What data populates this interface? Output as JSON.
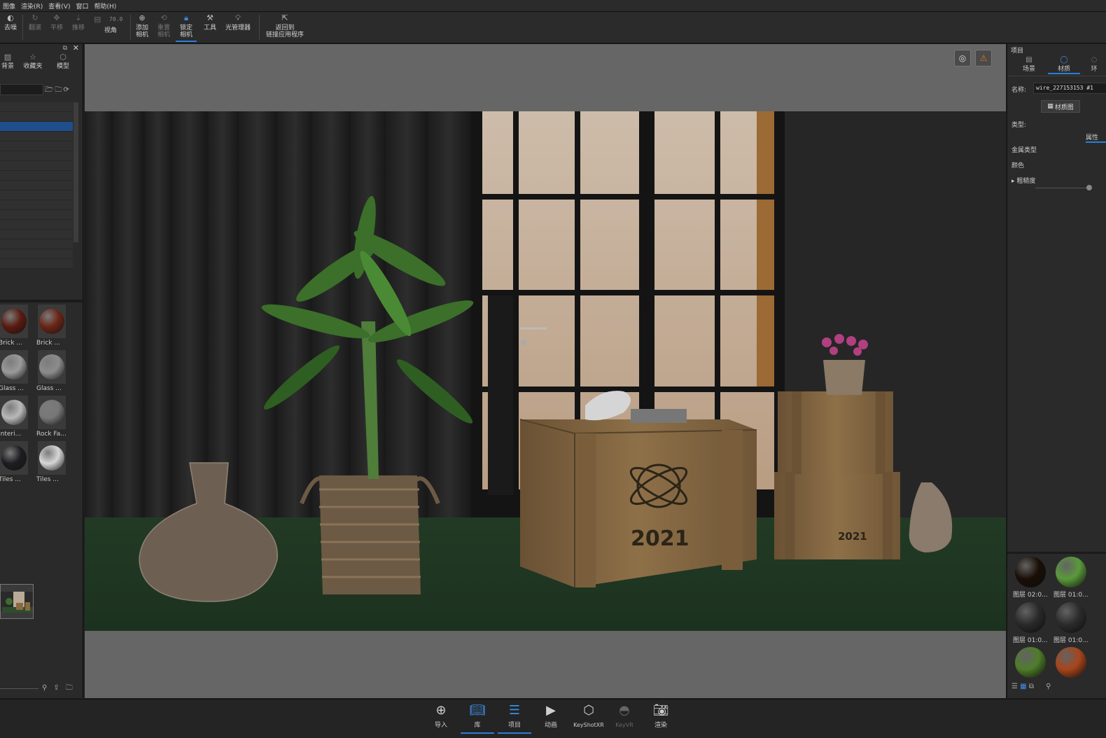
{
  "menu": [
    "图像",
    "渲染(R)",
    "查看(V)",
    "窗口",
    "帮助(H)"
  ],
  "toolbar": {
    "denoise": "去噪",
    "tumble": "翻滚",
    "pan": "平移",
    "dolly": "推移",
    "fov_value": "70.0",
    "view_angle": "视角",
    "add_camera_1": "添加",
    "add_camera_2": "相机",
    "reset_camera_1": "重置",
    "reset_camera_2": "相机",
    "lock_camera_1": "锁定",
    "lock_camera_2": "相机",
    "tools": "工具",
    "light_manager": "光管理器",
    "return_1": "返回到",
    "return_2": "链接应用程序"
  },
  "library": {
    "tabs": [
      "背景",
      "收藏夹",
      "模型"
    ],
    "materials": [
      {
        "label": "Brick ...",
        "color": "#5a1a10"
      },
      {
        "label": "Brick ...",
        "color": "#6a2414"
      },
      {
        "label": "Glass ...",
        "color": "#9a9a9a"
      },
      {
        "label": "Glass ...",
        "color": "#8c8c8c"
      },
      {
        "label": "Interi...",
        "color": "#b9b9b9"
      },
      {
        "label": "Rock Fa...",
        "color": "#777777"
      },
      {
        "label": "Tiles ...",
        "color": "#1d1d22"
      },
      {
        "label": "Tiles ...",
        "color": "#d6d6d6"
      }
    ]
  },
  "viewport": {
    "crate_text": "2021"
  },
  "project": {
    "title": "项目",
    "tabs": [
      "场景",
      "材质",
      "环"
    ],
    "name_label": "名称:",
    "name_value": "wire_227153153 #1",
    "material_graph": "材质图",
    "type_label": "类型:",
    "type_value": "属性",
    "metal_type_label": "金属类型",
    "color_label": "颜色",
    "roughness_label": "粗糙度",
    "scene_materials": [
      {
        "label": "图层 02:0...",
        "color": "#1a0f08"
      },
      {
        "label": "图层 01:0...",
        "color": "#5a9a3a"
      },
      {
        "label": "图层 01:0...",
        "color": "#2a2a2a"
      },
      {
        "label": "图层 01:0...",
        "color": "#2c2c2c"
      },
      {
        "label": "",
        "color": "#4f7d2a"
      },
      {
        "label": "",
        "color": "#a8451c"
      }
    ]
  },
  "bottombar": [
    "导入",
    "库",
    "项目",
    "动画",
    "KeyShotXR",
    "KeyVR",
    "渲染"
  ],
  "colors": {
    "accent": "#2a7fd8",
    "warning": "#e07a1a"
  }
}
